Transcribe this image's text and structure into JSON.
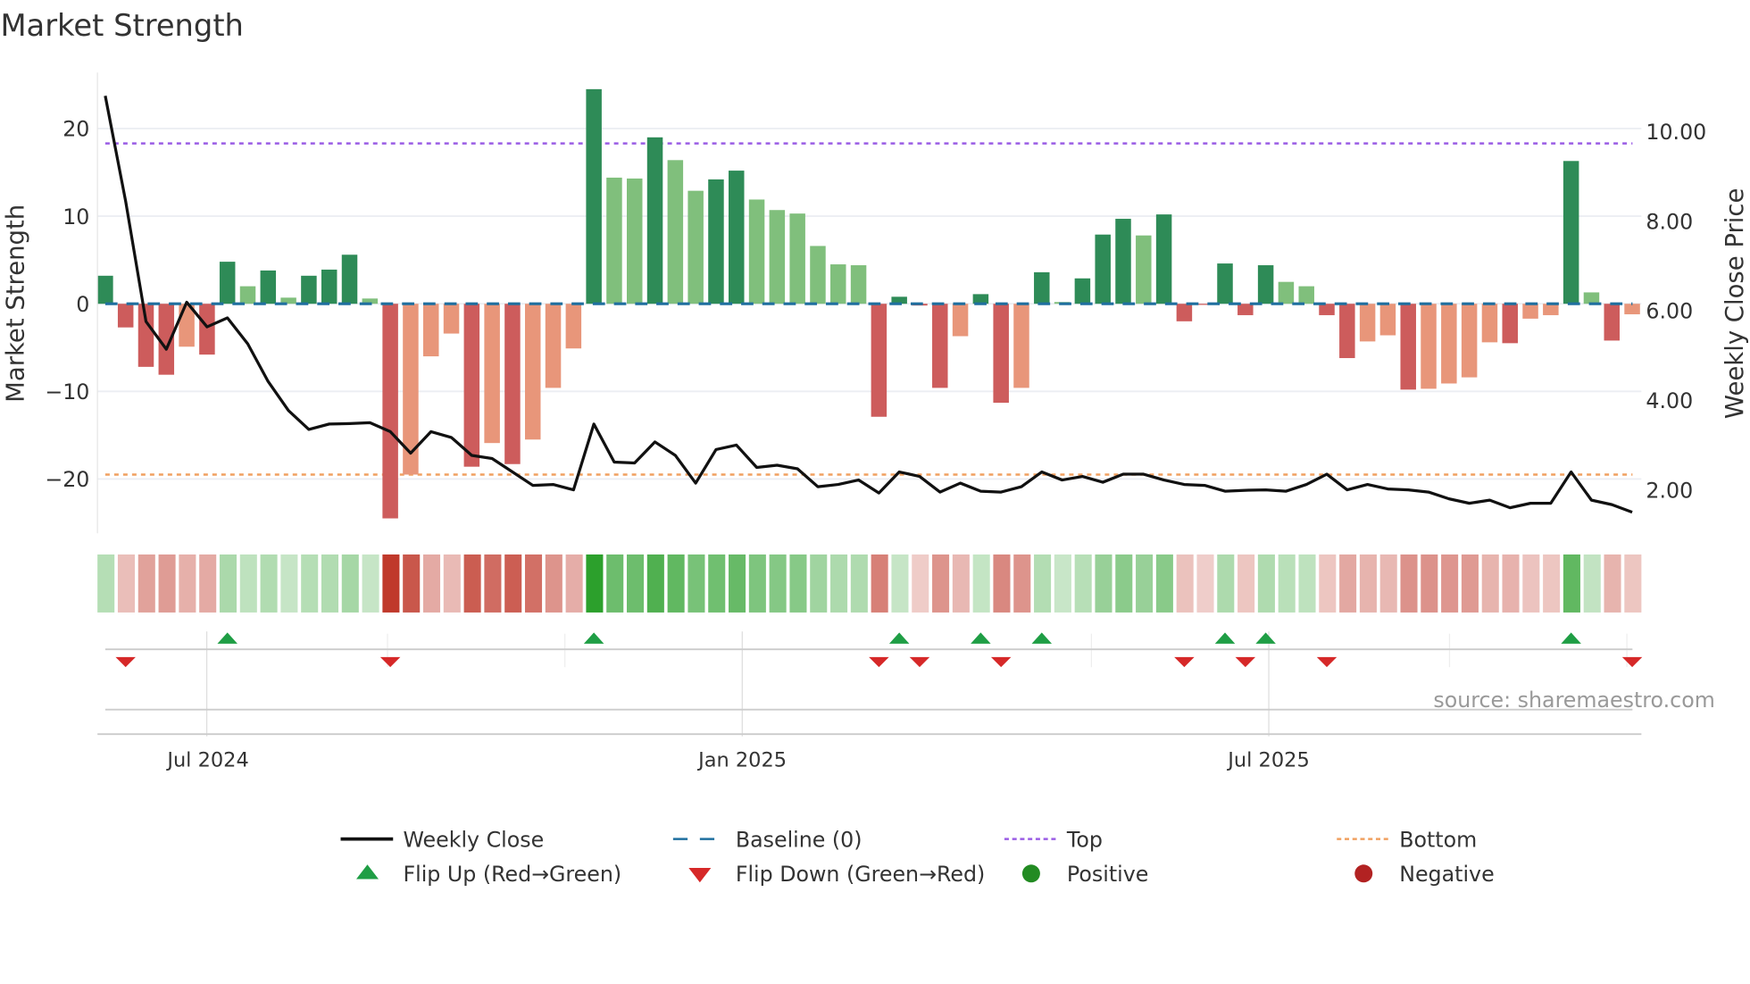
{
  "title": "Market Strength",
  "source": "source: sharemaestro.com",
  "chart_data": {
    "type": "bar",
    "title": "Market Strength",
    "ylabel": "Market Strength",
    "y2label": "Weekly Close Price",
    "ylim": [
      -26.2,
      26.4
    ],
    "y2lim": [
      1.03,
      11.32
    ],
    "yticks": [
      -20,
      -10,
      0,
      10,
      20
    ],
    "yticklabels": [
      "−20",
      "−10",
      "0",
      "10",
      "20"
    ],
    "y2ticks": [
      2,
      4,
      6,
      8,
      10
    ],
    "y2ticklabels": [
      "2.00",
      "4.00",
      "6.00",
      "8.00",
      "10.00"
    ],
    "xticks": [
      {
        "index": 5.05,
        "label": "Jul 2024"
      },
      {
        "index": 31.3,
        "label": "Jan 2025"
      },
      {
        "index": 57.15,
        "label": "Jul 2025"
      }
    ],
    "top_line": 18.3,
    "bottom_line": -19.5,
    "baseline": 0,
    "strength": [
      3.2,
      -2.7,
      -7.2,
      -8.1,
      -4.9,
      -5.8,
      4.8,
      2.0,
      3.8,
      0.7,
      3.2,
      3.9,
      5.6,
      0.6,
      -24.5,
      -19.5,
      -6.0,
      -3.4,
      -18.6,
      -15.9,
      -18.3,
      -15.5,
      -9.6,
      -5.1,
      24.5,
      14.4,
      14.3,
      19.0,
      16.4,
      12.9,
      14.2,
      15.2,
      11.9,
      10.7,
      10.3,
      6.6,
      4.5,
      4.4,
      -12.9,
      0.8,
      -0.2,
      -9.6,
      -3.7,
      1.1,
      -11.3,
      -9.6,
      3.6,
      0.2,
      2.9,
      7.9,
      9.7,
      7.8,
      10.2,
      -2.0,
      -0.1,
      4.6,
      -1.3,
      4.4,
      2.5,
      2.0,
      -1.3,
      -6.2,
      -4.3,
      -3.6,
      -9.8,
      -9.7,
      -9.1,
      -8.4,
      -4.4,
      -4.5,
      -1.7,
      -1.3,
      16.3,
      1.3,
      -4.2,
      -1.2
    ],
    "strong": [
      1,
      1,
      1,
      1,
      0,
      1,
      1,
      0,
      1,
      0,
      1,
      1,
      1,
      0,
      1,
      0,
      0,
      0,
      1,
      0,
      1,
      0,
      0,
      0,
      1,
      0,
      0,
      1,
      0,
      0,
      1,
      1,
      0,
      0,
      0,
      0,
      0,
      0,
      1,
      1,
      1,
      1,
      0,
      1,
      1,
      0,
      1,
      0,
      1,
      1,
      1,
      0,
      1,
      1,
      1,
      1,
      1,
      1,
      0,
      0,
      1,
      1,
      0,
      0,
      1,
      0,
      0,
      0,
      0,
      1,
      0,
      0,
      1,
      0,
      1,
      0
    ],
    "weekly_close": [
      10.8,
      8.45,
      5.76,
      5.14,
      6.19,
      5.64,
      5.84,
      5.26,
      4.42,
      3.77,
      3.35,
      3.47,
      3.48,
      3.5,
      3.3,
      2.82,
      3.3,
      3.17,
      2.77,
      2.7,
      2.4,
      2.1,
      2.12,
      2.0,
      3.47,
      2.62,
      2.6,
      3.07,
      2.77,
      2.15,
      2.9,
      3.0,
      2.5,
      2.55,
      2.47,
      2.07,
      2.12,
      2.22,
      1.93,
      2.4,
      2.3,
      1.95,
      2.15,
      1.97,
      1.95,
      2.07,
      2.4,
      2.22,
      2.3,
      2.17,
      2.35,
      2.35,
      2.22,
      2.12,
      2.1,
      1.97,
      1.99,
      2.0,
      1.97,
      2.12,
      2.35,
      2.0,
      2.12,
      2.02,
      2.0,
      1.95,
      1.8,
      1.7,
      1.77,
      1.6,
      1.7,
      1.7,
      2.4,
      1.77,
      1.67,
      1.5
    ],
    "flip_up": [
      6,
      24,
      39,
      43,
      46,
      55,
      57,
      72
    ],
    "flip_down": [
      1,
      14,
      38,
      40,
      44,
      53,
      56,
      60,
      75
    ],
    "colors": {
      "strong_pos": "#2e8b57",
      "weak_pos": "#80bf7c",
      "strong_neg": "#cd5c5c",
      "weak_neg": "#e8967a",
      "close": "#111111",
      "baseline": "#1f6f9f",
      "top": "#9b5de5",
      "bottom": "#f0a060",
      "flip_up": "#1f9e45",
      "flip_down": "#d62828",
      "positive": "#228b22",
      "negative": "#b22222"
    },
    "legend": [
      {
        "label": "Weekly Close",
        "symbol": "line"
      },
      {
        "label": "Baseline (0)",
        "symbol": "dash"
      },
      {
        "label": "Top",
        "symbol": "dot-purple"
      },
      {
        "label": "Bottom",
        "symbol": "dot-orange"
      },
      {
        "label": "Flip Up (Red→Green)",
        "symbol": "tri-up"
      },
      {
        "label": "Flip Down (Green→Red)",
        "symbol": "tri-down"
      },
      {
        "label": "Positive",
        "symbol": "circle-green"
      },
      {
        "label": "Negative",
        "symbol": "circle-red"
      }
    ]
  }
}
